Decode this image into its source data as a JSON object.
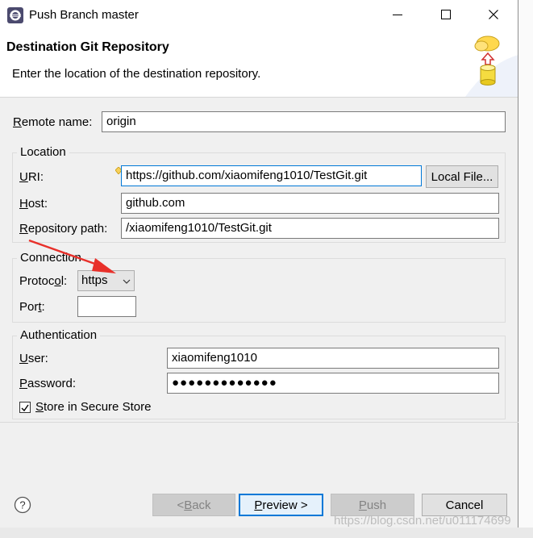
{
  "window": {
    "title": "Push Branch master"
  },
  "banner": {
    "title": "Destination Git Repository",
    "message": "Enter the location of the destination repository."
  },
  "remote": {
    "label_prefix": "R",
    "label_rest": "emote name:",
    "value": "origin"
  },
  "location": {
    "title": "Location",
    "uri_label_prefix": "U",
    "uri_label_rest": "RI:",
    "uri_value": "https://github.com/xiaomifeng1010/TestGit.git",
    "local_file_button": "Local File...",
    "host_label_prefix": "H",
    "host_label_rest": "ost:",
    "host_value": "github.com",
    "repo_label_prefix": "R",
    "repo_label_rest": "epository path:",
    "repo_value": "/xiaomifeng1010/TestGit.git"
  },
  "connection": {
    "title": "Connection",
    "protocol_label_a": "Protoc",
    "protocol_label_u": "o",
    "protocol_label_b": "l:",
    "protocol_value": "https",
    "port_label_a": "Por",
    "port_label_u": "t",
    "port_label_b": ":",
    "port_value": ""
  },
  "authentication": {
    "title": "Authentication",
    "user_label_u": "U",
    "user_label_rest": "ser:",
    "user_value": "xiaomifeng1010",
    "password_label_u": "P",
    "password_label_rest": "assword:",
    "password_value": "●●●●●●●●●●●●●",
    "store_label_u": "S",
    "store_label_rest": "tore in Secure Store",
    "store_checked": true
  },
  "footer": {
    "back_prefix": "< ",
    "back_u": "B",
    "back_rest": "ack",
    "preview_u": "P",
    "preview_rest": "review >",
    "push_u": "P",
    "push_rest": "ush",
    "cancel": "Cancel"
  },
  "watermark": "https://blog.csdn.net/u011174699",
  "colors": {
    "accent": "#0078d7",
    "arrow": "#e8302a"
  }
}
